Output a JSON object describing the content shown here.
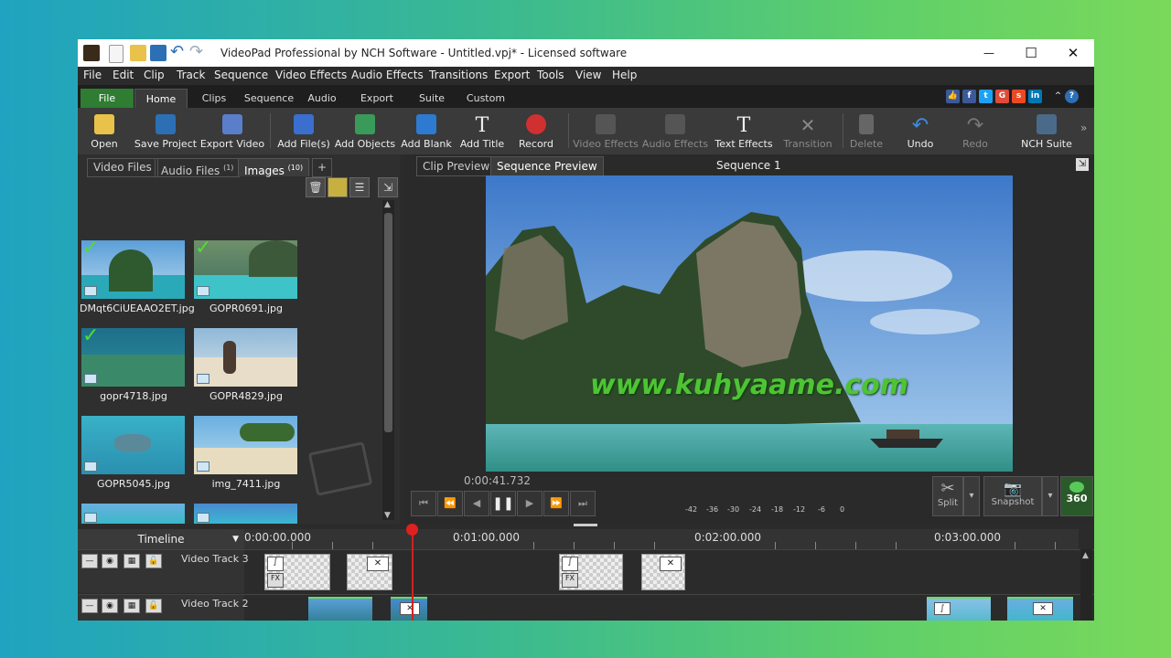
{
  "app": {
    "title": "VideoPad Professional by NCH Software - Untitled.vpj* - Licensed software",
    "window_controls": [
      "—",
      "☐",
      "✕"
    ]
  },
  "menu": [
    "File",
    "Edit",
    "Clip",
    "Track",
    "Sequence",
    "Video Effects",
    "Audio Effects",
    "Transitions",
    "Export",
    "Tools",
    "View",
    "Help"
  ],
  "ribbon_tabs": [
    "File",
    "Home",
    "Clips",
    "Sequence",
    "Audio",
    "Export",
    "Suite",
    "Custom"
  ],
  "toolbar": {
    "open": "Open",
    "save_project": "Save Project",
    "export_video": "Export Video",
    "add_files": "Add File(s)",
    "add_objects": "Add Objects",
    "add_blank": "Add Blank",
    "add_title": "Add Title",
    "record": "Record",
    "video_effects": "Video Effects",
    "audio_effects": "Audio Effects",
    "text_effects": "Text Effects",
    "transition": "Transition",
    "delete": "Delete",
    "undo": "Undo",
    "redo": "Redo",
    "nch_suite": "NCH Suite"
  },
  "media_panel": {
    "tabs": [
      {
        "label": "Video Files",
        "count": ""
      },
      {
        "label": "Audio Files",
        "count": "(1)"
      },
      {
        "label": "Images",
        "count": "(10)"
      }
    ],
    "add_tab": "+",
    "items": [
      {
        "name": "DMqt6CiUEAAO2ET.jpg",
        "used": true
      },
      {
        "name": "GOPR0691.jpg",
        "used": true
      },
      {
        "name": "gopr4718.jpg",
        "used": true
      },
      {
        "name": "GOPR4829.jpg",
        "used": false
      },
      {
        "name": "GOPR5045.jpg",
        "used": false
      },
      {
        "name": "img_7411.jpg",
        "used": false
      },
      {
        "name": "",
        "used": false
      },
      {
        "name": "",
        "used": false
      }
    ]
  },
  "preview": {
    "tabs": [
      "Clip Preview",
      "Sequence Preview"
    ],
    "sequence_name": "Sequence 1",
    "watermark": "www.kuhyaame.com",
    "timecode": "0:00:41.732",
    "meter_labels": [
      "-42",
      "-36",
      "-30",
      "-24",
      "-18",
      "-12",
      "-6",
      "0"
    ],
    "split": "Split",
    "snapshot": "Snapshot",
    "vr": "360"
  },
  "timeline": {
    "label": "Timeline",
    "ruler": [
      "0:00:00.000",
      "0:01:00.000",
      "0:02:00.000",
      "0:03:00.000"
    ],
    "tracks": [
      "Video Track 3",
      "Video Track 2"
    ]
  },
  "colors": {
    "accent_green": "#2e7d32",
    "playhead_red": "#e02020",
    "watermark_green": "#4ec434"
  }
}
